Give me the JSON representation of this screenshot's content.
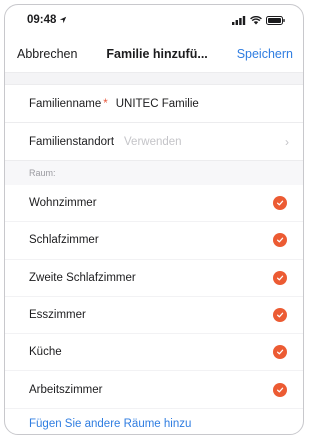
{
  "status_bar": {
    "time": "09:48"
  },
  "nav": {
    "cancel": "Abbrechen",
    "title": "Familie hinzufü...",
    "save": "Speichern"
  },
  "form": {
    "family_name_label": "Familienname",
    "family_name_required": "*",
    "family_name_value": "UNITEC Familie",
    "location_label": "Familienstandort",
    "location_placeholder": "Verwenden"
  },
  "rooms": {
    "header": "Raum:",
    "items": [
      {
        "label": "Wohnzimmer",
        "checked": true
      },
      {
        "label": "Schlafzimmer",
        "checked": true
      },
      {
        "label": "Zweite Schlafzimmer",
        "checked": true
      },
      {
        "label": "Esszimmer",
        "checked": true
      },
      {
        "label": "Küche",
        "checked": true
      },
      {
        "label": "Arbeitszimmer",
        "checked": true
      }
    ],
    "add_more": "Fügen Sie andere Räume hinzu"
  },
  "colors": {
    "accent": "#2f7de1",
    "check": "#ec5b33",
    "required": "#e8593d"
  }
}
